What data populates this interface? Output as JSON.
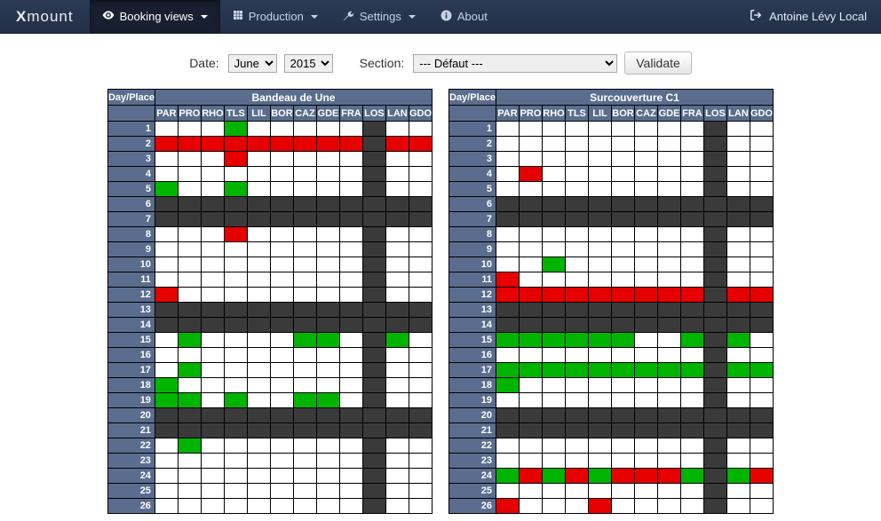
{
  "nav": {
    "brand_prefix": "X",
    "brand_rest": "mount",
    "items": [
      {
        "label": "Booking views",
        "icon": "eye",
        "caret": true,
        "active": true
      },
      {
        "label": "Production",
        "icon": "grid",
        "caret": true,
        "active": false
      },
      {
        "label": "Settings",
        "icon": "wrench",
        "caret": true,
        "active": false
      },
      {
        "label": "About",
        "icon": "info",
        "caret": false,
        "active": false
      }
    ],
    "user": "Antoine Lévy Local"
  },
  "toolbar": {
    "date_label": "Date:",
    "month_value": "June",
    "year_value": "2015",
    "section_label": "Section:",
    "section_value": "--- Défaut ---",
    "validate_label": "Validate"
  },
  "places": [
    "PAR",
    "PRO",
    "RHO",
    "TLS",
    "LIL",
    "BOR",
    "CAZ",
    "GDE",
    "FRA",
    "LOS",
    "LAN",
    "GDO"
  ],
  "grids": [
    {
      "title": "Bandeau de Une",
      "corner": "Day/Place",
      "rows": [
        {
          "day": "1",
          "cells": [
            "w",
            "w",
            "w",
            "g",
            "w",
            "w",
            "w",
            "w",
            "w",
            "d",
            "w",
            "w"
          ]
        },
        {
          "day": "2",
          "cells": [
            "r",
            "r",
            "r",
            "r",
            "r",
            "r",
            "r",
            "r",
            "r",
            "d",
            "r",
            "r"
          ]
        },
        {
          "day": "3",
          "cells": [
            "w",
            "w",
            "w",
            "r",
            "w",
            "w",
            "w",
            "w",
            "w",
            "d",
            "w",
            "w"
          ]
        },
        {
          "day": "4",
          "cells": [
            "w",
            "w",
            "w",
            "w",
            "w",
            "w",
            "w",
            "w",
            "w",
            "d",
            "w",
            "w"
          ]
        },
        {
          "day": "5",
          "cells": [
            "g",
            "w",
            "w",
            "g",
            "w",
            "w",
            "w",
            "w",
            "w",
            "d",
            "w",
            "w"
          ]
        },
        {
          "day": "6",
          "cells": [
            "d",
            "d",
            "d",
            "d",
            "d",
            "d",
            "d",
            "d",
            "d",
            "d",
            "d",
            "d"
          ]
        },
        {
          "day": "7",
          "cells": [
            "d",
            "d",
            "d",
            "d",
            "d",
            "d",
            "d",
            "d",
            "d",
            "d",
            "d",
            "d"
          ]
        },
        {
          "day": "8",
          "cells": [
            "w",
            "w",
            "w",
            "r",
            "w",
            "w",
            "w",
            "w",
            "w",
            "d",
            "w",
            "w"
          ]
        },
        {
          "day": "9",
          "cells": [
            "w",
            "w",
            "w",
            "w",
            "w",
            "w",
            "w",
            "w",
            "w",
            "d",
            "w",
            "w"
          ]
        },
        {
          "day": "10",
          "cells": [
            "w",
            "w",
            "w",
            "w",
            "w",
            "w",
            "w",
            "w",
            "w",
            "d",
            "w",
            "w"
          ]
        },
        {
          "day": "11",
          "cells": [
            "w",
            "w",
            "w",
            "w",
            "w",
            "w",
            "w",
            "w",
            "w",
            "d",
            "w",
            "w"
          ]
        },
        {
          "day": "12",
          "cells": [
            "r",
            "w",
            "w",
            "w",
            "w",
            "w",
            "w",
            "w",
            "w",
            "d",
            "w",
            "w"
          ]
        },
        {
          "day": "13",
          "cells": [
            "d",
            "d",
            "d",
            "d",
            "d",
            "d",
            "d",
            "d",
            "d",
            "d",
            "d",
            "d"
          ]
        },
        {
          "day": "14",
          "cells": [
            "d",
            "d",
            "d",
            "d",
            "d",
            "d",
            "d",
            "d",
            "d",
            "d",
            "d",
            "d"
          ]
        },
        {
          "day": "15",
          "cells": [
            "w",
            "g",
            "w",
            "w",
            "w",
            "w",
            "g",
            "g",
            "w",
            "d",
            "g",
            "w"
          ]
        },
        {
          "day": "16",
          "cells": [
            "w",
            "w",
            "w",
            "w",
            "w",
            "w",
            "w",
            "w",
            "w",
            "d",
            "w",
            "w"
          ]
        },
        {
          "day": "17",
          "cells": [
            "w",
            "g",
            "w",
            "w",
            "w",
            "w",
            "w",
            "w",
            "w",
            "d",
            "w",
            "w"
          ]
        },
        {
          "day": "18",
          "cells": [
            "g",
            "w",
            "w",
            "w",
            "w",
            "w",
            "w",
            "w",
            "w",
            "d",
            "w",
            "w"
          ]
        },
        {
          "day": "19",
          "cells": [
            "g",
            "g",
            "w",
            "g",
            "w",
            "w",
            "g",
            "g",
            "w",
            "d",
            "w",
            "w"
          ]
        },
        {
          "day": "20",
          "cells": [
            "d",
            "d",
            "d",
            "d",
            "d",
            "d",
            "d",
            "d",
            "d",
            "d",
            "d",
            "d"
          ]
        },
        {
          "day": "21",
          "cells": [
            "d",
            "d",
            "d",
            "d",
            "d",
            "d",
            "d",
            "d",
            "d",
            "d",
            "d",
            "d"
          ]
        },
        {
          "day": "22",
          "cells": [
            "w",
            "g",
            "w",
            "w",
            "w",
            "w",
            "w",
            "w",
            "w",
            "d",
            "w",
            "w"
          ]
        },
        {
          "day": "23",
          "cells": [
            "w",
            "w",
            "w",
            "w",
            "w",
            "w",
            "w",
            "w",
            "w",
            "d",
            "w",
            "w"
          ]
        },
        {
          "day": "24",
          "cells": [
            "w",
            "w",
            "w",
            "w",
            "w",
            "w",
            "w",
            "w",
            "w",
            "d",
            "w",
            "w"
          ]
        },
        {
          "day": "25",
          "cells": [
            "w",
            "w",
            "w",
            "w",
            "w",
            "w",
            "w",
            "w",
            "w",
            "d",
            "w",
            "w"
          ]
        },
        {
          "day": "26",
          "cells": [
            "w",
            "w",
            "w",
            "w",
            "w",
            "w",
            "w",
            "w",
            "w",
            "d",
            "w",
            "w"
          ]
        }
      ]
    },
    {
      "title": "Surcouverture C1",
      "corner": "Day/Place",
      "rows": [
        {
          "day": "1",
          "cells": [
            "w",
            "w",
            "w",
            "w",
            "w",
            "w",
            "w",
            "w",
            "w",
            "d",
            "w",
            "w"
          ]
        },
        {
          "day": "2",
          "cells": [
            "w",
            "w",
            "w",
            "w",
            "w",
            "w",
            "w",
            "w",
            "w",
            "d",
            "w",
            "w"
          ]
        },
        {
          "day": "3",
          "cells": [
            "w",
            "w",
            "w",
            "w",
            "w",
            "w",
            "w",
            "w",
            "w",
            "d",
            "w",
            "w"
          ]
        },
        {
          "day": "4",
          "cells": [
            "w",
            "r",
            "w",
            "w",
            "w",
            "w",
            "w",
            "w",
            "w",
            "d",
            "w",
            "w"
          ]
        },
        {
          "day": "5",
          "cells": [
            "w",
            "w",
            "w",
            "w",
            "w",
            "w",
            "w",
            "w",
            "w",
            "d",
            "w",
            "w"
          ]
        },
        {
          "day": "6",
          "cells": [
            "d",
            "d",
            "d",
            "d",
            "d",
            "d",
            "d",
            "d",
            "d",
            "d",
            "d",
            "d"
          ]
        },
        {
          "day": "7",
          "cells": [
            "d",
            "d",
            "d",
            "d",
            "d",
            "d",
            "d",
            "d",
            "d",
            "d",
            "d",
            "d"
          ]
        },
        {
          "day": "8",
          "cells": [
            "w",
            "w",
            "w",
            "w",
            "w",
            "w",
            "w",
            "w",
            "w",
            "d",
            "w",
            "w"
          ]
        },
        {
          "day": "9",
          "cells": [
            "w",
            "w",
            "w",
            "w",
            "w",
            "w",
            "w",
            "w",
            "w",
            "d",
            "w",
            "w"
          ]
        },
        {
          "day": "10",
          "cells": [
            "w",
            "w",
            "g",
            "w",
            "w",
            "w",
            "w",
            "w",
            "w",
            "d",
            "w",
            "w"
          ]
        },
        {
          "day": "11",
          "cells": [
            "r",
            "w",
            "w",
            "w",
            "w",
            "w",
            "w",
            "w",
            "w",
            "d",
            "w",
            "w"
          ]
        },
        {
          "day": "12",
          "cells": [
            "r",
            "r",
            "r",
            "r",
            "r",
            "r",
            "r",
            "r",
            "r",
            "d",
            "r",
            "r"
          ]
        },
        {
          "day": "13",
          "cells": [
            "d",
            "d",
            "d",
            "d",
            "d",
            "d",
            "d",
            "d",
            "d",
            "d",
            "d",
            "d"
          ]
        },
        {
          "day": "14",
          "cells": [
            "d",
            "d",
            "d",
            "d",
            "d",
            "d",
            "d",
            "d",
            "d",
            "d",
            "d",
            "d"
          ]
        },
        {
          "day": "15",
          "cells": [
            "g",
            "g",
            "g",
            "g",
            "g",
            "g",
            "w",
            "w",
            "g",
            "d",
            "g",
            "w"
          ]
        },
        {
          "day": "16",
          "cells": [
            "w",
            "w",
            "w",
            "w",
            "w",
            "w",
            "w",
            "w",
            "w",
            "d",
            "w",
            "w"
          ]
        },
        {
          "day": "17",
          "cells": [
            "g",
            "g",
            "g",
            "g",
            "g",
            "g",
            "g",
            "g",
            "g",
            "d",
            "g",
            "g"
          ]
        },
        {
          "day": "18",
          "cells": [
            "g",
            "w",
            "w",
            "w",
            "w",
            "w",
            "w",
            "w",
            "w",
            "d",
            "w",
            "w"
          ]
        },
        {
          "day": "19",
          "cells": [
            "w",
            "w",
            "w",
            "w",
            "w",
            "w",
            "w",
            "w",
            "w",
            "d",
            "w",
            "w"
          ]
        },
        {
          "day": "20",
          "cells": [
            "d",
            "d",
            "d",
            "d",
            "d",
            "d",
            "d",
            "d",
            "d",
            "d",
            "d",
            "d"
          ]
        },
        {
          "day": "21",
          "cells": [
            "d",
            "d",
            "d",
            "d",
            "d",
            "d",
            "d",
            "d",
            "d",
            "d",
            "d",
            "d"
          ]
        },
        {
          "day": "22",
          "cells": [
            "w",
            "w",
            "w",
            "w",
            "w",
            "w",
            "w",
            "w",
            "w",
            "d",
            "w",
            "w"
          ]
        },
        {
          "day": "23",
          "cells": [
            "w",
            "w",
            "w",
            "w",
            "w",
            "w",
            "w",
            "w",
            "w",
            "d",
            "w",
            "w"
          ]
        },
        {
          "day": "24",
          "cells": [
            "g",
            "r",
            "g",
            "r",
            "g",
            "r",
            "r",
            "r",
            "g",
            "d",
            "g",
            "r"
          ]
        },
        {
          "day": "25",
          "cells": [
            "w",
            "w",
            "w",
            "w",
            "w",
            "w",
            "w",
            "w",
            "w",
            "d",
            "w",
            "w"
          ]
        },
        {
          "day": "26",
          "cells": [
            "r",
            "w",
            "w",
            "w",
            "r",
            "w",
            "w",
            "w",
            "w",
            "d",
            "w",
            "w"
          ]
        }
      ]
    }
  ]
}
